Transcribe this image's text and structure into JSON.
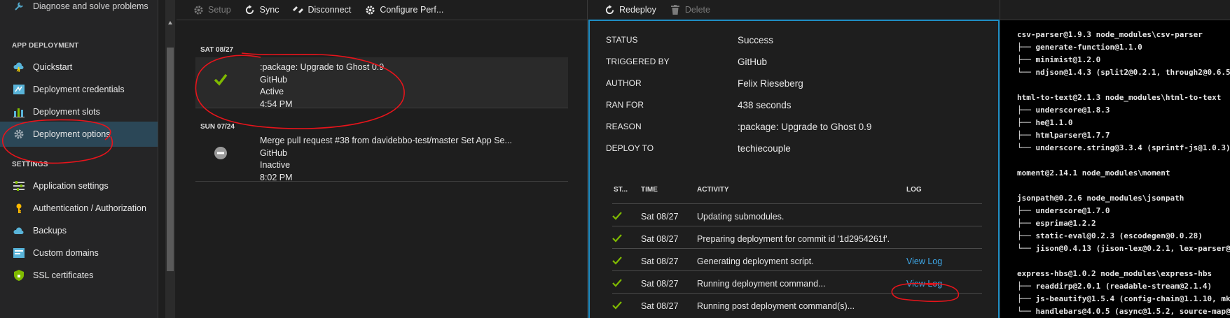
{
  "sidebar": {
    "partial_item": "Diagnose and solve problems",
    "section_app_deployment": "APP DEPLOYMENT",
    "section_settings": "SETTINGS",
    "items": [
      {
        "label": "Quickstart",
        "icon": "cloud-bolt-icon"
      },
      {
        "label": "Deployment credentials",
        "icon": "credentials-icon"
      },
      {
        "label": "Deployment slots",
        "icon": "slots-icon"
      },
      {
        "label": "Deployment options",
        "icon": "gear-icon"
      },
      {
        "label": "Application settings",
        "icon": "settings-list-icon"
      },
      {
        "label": "Authentication / Authorization",
        "icon": "key-icon"
      },
      {
        "label": "Backups",
        "icon": "backup-cloud-icon"
      },
      {
        "label": "Custom domains",
        "icon": "domains-icon"
      },
      {
        "label": "SSL certificates",
        "icon": "shield-icon"
      }
    ],
    "selected_index": 3
  },
  "toolbar_deployments": {
    "setup": "Setup",
    "sync": "Sync",
    "disconnect": "Disconnect",
    "configure": "Configure Perf..."
  },
  "toolbar_details": {
    "redeploy": "Redeploy",
    "delete": "Delete"
  },
  "deployments": {
    "groups": [
      {
        "date": "SAT 08/27",
        "item": {
          "title": ":package: Upgrade to Ghost 0.9",
          "source": "GitHub",
          "state": "Active",
          "time": "4:54 PM",
          "status": "success"
        }
      },
      {
        "date": "SUN 07/24",
        "item": {
          "title": "Merge pull request #38 from davidebbo-test/master Set App Se...",
          "source": "GitHub",
          "state": "Inactive",
          "time": "8:02 PM",
          "status": "inactive"
        }
      }
    ]
  },
  "details": {
    "fields": [
      {
        "key": "STATUS",
        "value": "Success"
      },
      {
        "key": "TRIGGERED BY",
        "value": "GitHub"
      },
      {
        "key": "AUTHOR",
        "value": "Felix Rieseberg"
      },
      {
        "key": "RAN FOR",
        "value": "438 seconds"
      },
      {
        "key": "REASON",
        "value": ":package: Upgrade to Ghost 0.9"
      },
      {
        "key": "DEPLOY TO",
        "value": "techiecouple"
      }
    ],
    "columns": {
      "status": "ST...",
      "time": "TIME",
      "activity": "ACTIVITY",
      "log": "LOG"
    },
    "activities": [
      {
        "time": "Sat 08/27",
        "activity": "Updating submodules.",
        "log": ""
      },
      {
        "time": "Sat 08/27",
        "activity": "Preparing deployment for commit id '1d2954261f'.",
        "log": ""
      },
      {
        "time": "Sat 08/27",
        "activity": "Generating deployment script.",
        "log": "View Log"
      },
      {
        "time": "Sat 08/27",
        "activity": "Running deployment command...",
        "log": "View Log"
      },
      {
        "time": "Sat 08/27",
        "activity": "Running post deployment command(s)...",
        "log": ""
      }
    ]
  },
  "log_output": {
    "lines": [
      "csv-parser@1.9.3 node_modules\\csv-parser",
      "├── generate-function@1.1.0",
      "├── minimist@1.2.0",
      "└── ndjson@1.4.3 (split2@0.2.1, through2@0.6.5",
      "",
      "html-to-text@2.1.3 node_modules\\html-to-text",
      "├── underscore@1.8.3",
      "├── he@1.1.0",
      "├── htmlparser@1.7.7",
      "└── underscore.string@3.3.4 (sprintf-js@1.0.3)",
      "",
      "moment@2.14.1 node_modules\\moment",
      "",
      "jsonpath@0.2.6 node_modules\\jsonpath",
      "├── underscore@1.7.0",
      "├── esprima@1.2.2",
      "├── static-eval@0.2.3 (escodegen@0.0.28)",
      "└── jison@0.4.13 (jison-lex@0.2.1, lex-parser@",
      "",
      "express-hbs@1.0.2 node_modules\\express-hbs",
      "├── readdirp@2.0.1 (readable-stream@2.1.4)",
      "├── js-beautify@1.5.4 (config-chain@1.1.10, mk",
      "└── handlebars@4.0.5 (async@1.5.2, source-map@"
    ]
  },
  "colors": {
    "accent_blue": "#1f8ec4",
    "success_green": "#7fba00",
    "link_blue": "#3ea8e8",
    "selected_nav": "#2b4757",
    "annotation_red": "#e8141b"
  }
}
